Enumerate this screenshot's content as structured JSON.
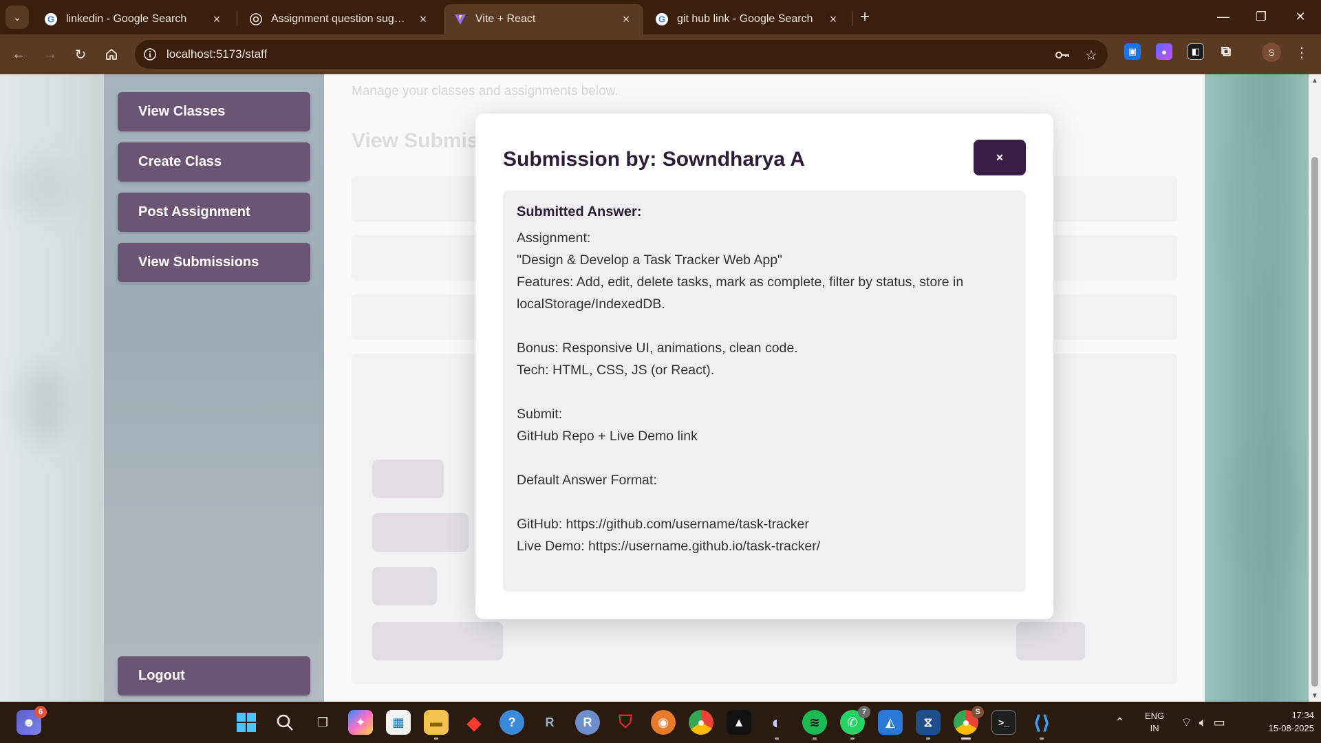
{
  "browser": {
    "tabs": [
      {
        "title": "linkedin - Google Search",
        "favicon": "google-icon"
      },
      {
        "title": "Assignment question suggestio",
        "favicon": "chatgpt-icon"
      },
      {
        "title": "Vite + React",
        "favicon": "vite-icon",
        "active": true
      },
      {
        "title": "git hub link - Google Search",
        "favicon": "google-icon"
      }
    ],
    "url": "localhost:5173/staff"
  },
  "sidebar": {
    "items": [
      {
        "label": "View Classes"
      },
      {
        "label": "Create Class"
      },
      {
        "label": "Post Assignment"
      },
      {
        "label": "View Submissions"
      }
    ],
    "logout_label": "Logout"
  },
  "main": {
    "subtitle": "Manage your classes and assignments below.",
    "heading": "View Submis"
  },
  "modal": {
    "title": "Submission by: Sowndharya A",
    "close_label": "×",
    "answer_label": "Submitted Answer:",
    "answer_text": "Assignment:\n\"Design & Develop a Task Tracker Web App\"\nFeatures: Add, edit, delete tasks, mark as complete, filter by status, store in localStorage/IndexedDB.\n\nBonus: Responsive UI, animations, clean code.\nTech: HTML, CSS, JS (or React).\n\nSubmit:\nGitHub Repo + Live Demo link\n\nDefault Answer Format:\n\nGitHub: https://github.com/username/task-tracker\nLive Demo: https://username.github.io/task-tracker/"
  },
  "taskbar": {
    "teams_badge": "6",
    "whatsapp_badge": "7",
    "chrome_badge": "S",
    "language_line1": "ENG",
    "language_line2": "IN",
    "time": "17:34",
    "date": "15-08-2025"
  },
  "colors": {
    "accent": "#3a1d47",
    "chrome_bg": "#3a1f0d",
    "toolbar_bg": "#5a3a22"
  }
}
